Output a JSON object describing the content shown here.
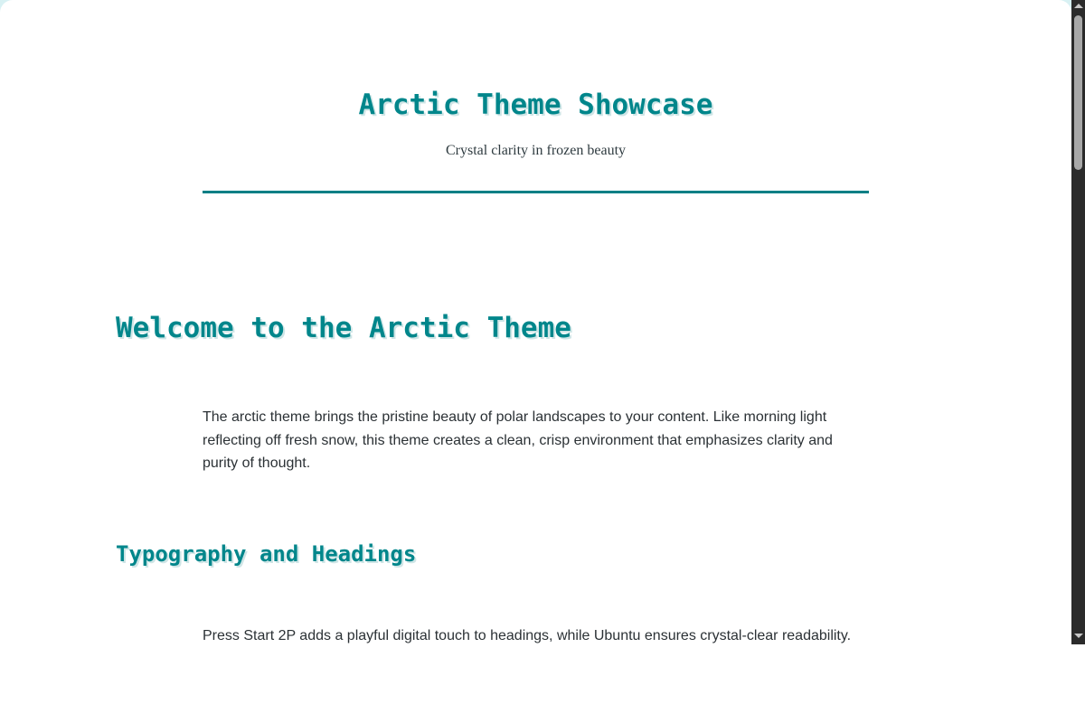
{
  "header": {
    "title": "Arctic Theme Showcase",
    "tagline": "Crystal clarity in frozen beauty"
  },
  "main": {
    "section_1": {
      "heading": "Welcome to the Arctic Theme",
      "paragraph": "The arctic theme brings the pristine beauty of polar landscapes to your content. Like morning light reflecting off fresh snow, this theme creates a clean, crisp environment that emphasizes clarity and purity of thought."
    },
    "section_2": {
      "heading": "Typography and Headings",
      "paragraph": "Press Start 2P adds a playful digital touch to headings, while Ubuntu ensures crystal-clear readability."
    }
  },
  "colors": {
    "accent": "#00868b",
    "rule": "#007f85",
    "text": "#2b3135",
    "scrollbar_track": "#2b2b2b",
    "scrollbar_thumb": "#a8a8a8"
  },
  "scrollbar": {
    "up_icon": "triangle-up-icon",
    "down_icon": "triangle-down-icon"
  }
}
